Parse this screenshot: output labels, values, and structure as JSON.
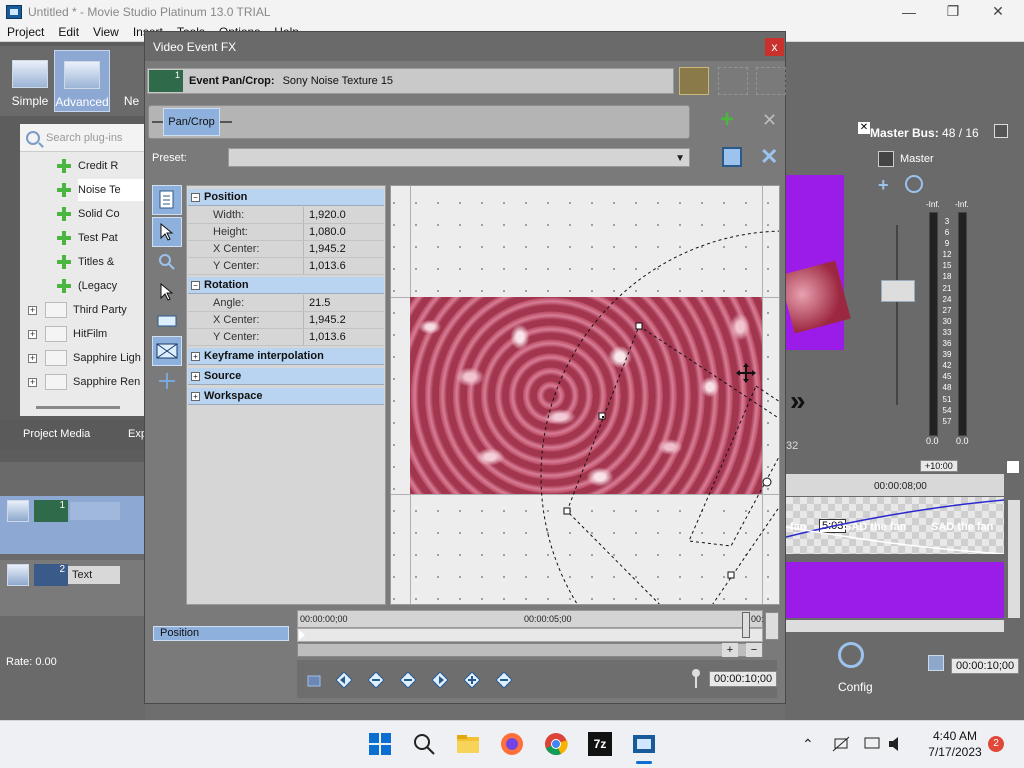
{
  "window": {
    "title": "Untitled * - Movie Studio Platinum 13.0 TRIAL",
    "menus": [
      "Project",
      "Edit",
      "View",
      "Insert",
      "Tools",
      "Options",
      "Help"
    ]
  },
  "views": {
    "simple": "Simple",
    "advanced": "Advanced",
    "new": "Ne"
  },
  "plugins": {
    "search_placeholder": "Search plug-ins",
    "items": [
      "Credit R",
      "Noise Te",
      "Solid Co",
      "Test Pat",
      "Titles &",
      "(Legacy"
    ],
    "folders": [
      "Third Party",
      "HitFilm",
      "Sapphire Ligh",
      "Sapphire Ren"
    ]
  },
  "bottom_tabs": {
    "project_media": "Project Media",
    "explorer": "Exp"
  },
  "tracks": [
    {
      "num": "1",
      "name": ""
    },
    {
      "num": "2",
      "name": "Text"
    }
  ],
  "rate": "Rate: 0.00",
  "master": {
    "title": "Master Bus:",
    "value": "48 / 16",
    "label": "Master",
    "inf_left": "-Inf.",
    "inf_right": "-Inf.",
    "scale": [
      "3",
      "6",
      "9",
      "12",
      "15",
      "18",
      "21",
      "24",
      "27",
      "30",
      "33",
      "36",
      "39",
      "42",
      "45",
      "48",
      "51",
      "54",
      "57"
    ],
    "bottom_left": "0.0",
    "bottom_right": "0.0"
  },
  "timeline": {
    "ruler_offset": "+10:00",
    "ruler_time": "00:00:08;00",
    "clips": [
      "fan",
      "5:03",
      "SAD the fan",
      "SAD the fan"
    ],
    "frame_num": "32"
  },
  "config_label": "Config",
  "right_time": "00:00:10;00",
  "dialog": {
    "title": "Video Event FX",
    "close": "x",
    "fx_num": "1",
    "header_label": "Event Pan/Crop:",
    "header_value": "Sony Noise Texture 15",
    "chain_button": "Pan/Crop",
    "preset_label": "Preset:",
    "preset_value": "",
    "sections": {
      "position": "Position",
      "rotation": "Rotation",
      "keyframe": "Keyframe interpolation",
      "source": "Source",
      "workspace": "Workspace"
    },
    "position_rows": [
      {
        "k": "Width:",
        "v": "1,920.0"
      },
      {
        "k": "Height:",
        "v": "1,080.0"
      },
      {
        "k": "X Center:",
        "v": "1,945.2"
      },
      {
        "k": "Y Center:",
        "v": "1,013.6"
      }
    ],
    "rotation_rows": [
      {
        "k": "Angle:",
        "v": "21.5"
      },
      {
        "k": "X Center:",
        "v": "1,945.2"
      },
      {
        "k": "Y Center:",
        "v": "1,013.6"
      }
    ],
    "keyframe_label": "Position",
    "kf_times": [
      "00:00:00;00",
      "00:00:05;00",
      "00:"
    ],
    "kf_time": "00:00:10;00"
  },
  "taskbar": {
    "time": "4:40 AM",
    "date": "7/17/2023",
    "badge": "2"
  }
}
